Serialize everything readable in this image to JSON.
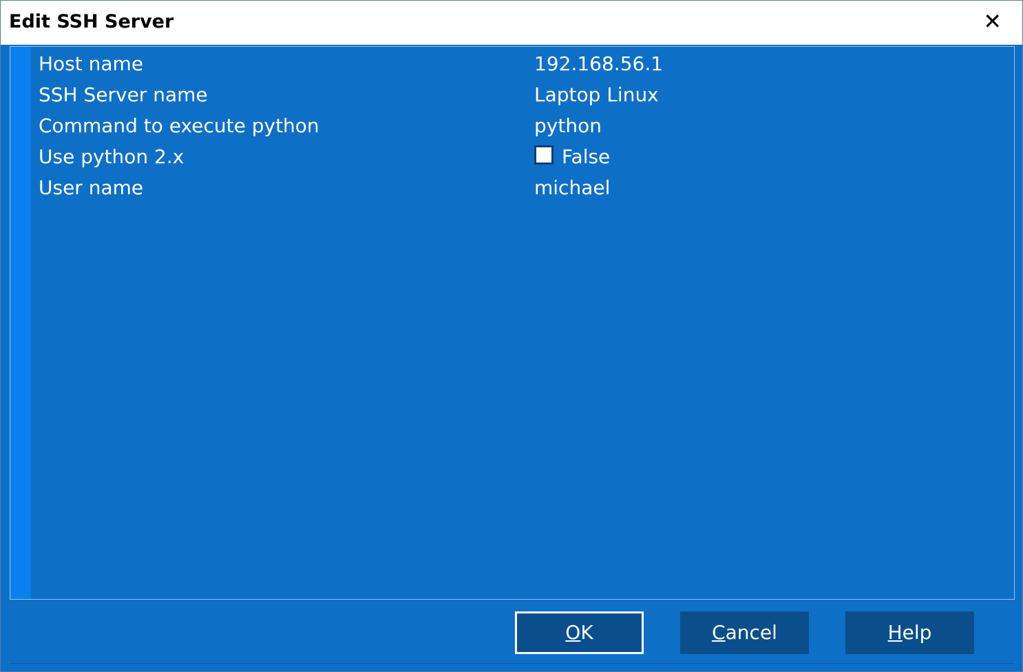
{
  "window": {
    "title": "Edit SSH Server",
    "close_icon": "close-icon"
  },
  "properties": [
    {
      "label": "Host name",
      "value": "192.168.56.1"
    },
    {
      "label": "SSH Server name",
      "value": "Laptop Linux"
    },
    {
      "label": "Command to execute python",
      "value": "python"
    },
    {
      "label": "Use python 2.x",
      "value": "False",
      "checked": false
    },
    {
      "label": "User name",
      "value": "michael"
    }
  ],
  "buttons": {
    "ok": {
      "mnemonic": "O",
      "rest": "K"
    },
    "cancel": {
      "mnemonic": "C",
      "rest": "ancel"
    },
    "help": {
      "mnemonic": "H",
      "rest": "elp"
    }
  }
}
